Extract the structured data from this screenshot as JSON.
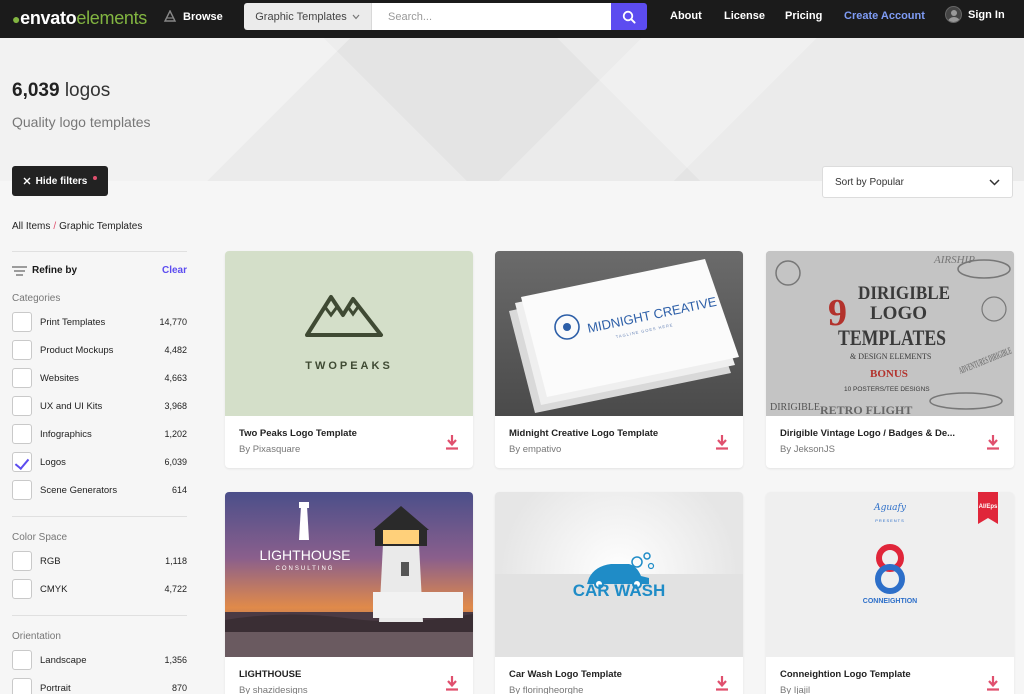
{
  "nav": {
    "logo_left": "envato",
    "logo_right": "elements",
    "browse": "Browse",
    "search_category": "Graphic Templates",
    "search_placeholder": "Search...",
    "links": {
      "about": "About",
      "license": "License",
      "pricing": "Pricing",
      "create": "Create Account",
      "signin": "Sign In"
    }
  },
  "hero": {
    "count": "6,039",
    "noun": "logos",
    "subtitle": "Quality logo templates"
  },
  "hide_filters": "Hide filters",
  "sort": "Sort by Popular",
  "breadcrumb": {
    "root": "All Items",
    "sep": "/",
    "current": "Graphic Templates"
  },
  "sidebar": {
    "refine": "Refine by",
    "clear": "Clear",
    "categories_title": "Categories",
    "categories": [
      {
        "label": "Print Templates",
        "count": "14,770",
        "checked": false
      },
      {
        "label": "Product Mockups",
        "count": "4,482",
        "checked": false
      },
      {
        "label": "Websites",
        "count": "4,663",
        "checked": false
      },
      {
        "label": "UX and UI Kits",
        "count": "3,968",
        "checked": false
      },
      {
        "label": "Infographics",
        "count": "1,202",
        "checked": false
      },
      {
        "label": "Logos",
        "count": "6,039",
        "checked": true
      },
      {
        "label": "Scene Generators",
        "count": "614",
        "checked": false
      }
    ],
    "color_title": "Color Space",
    "color": [
      {
        "label": "RGB",
        "count": "1,118"
      },
      {
        "label": "CMYK",
        "count": "4,722"
      }
    ],
    "orientation_title": "Orientation",
    "orientation": [
      {
        "label": "Landscape",
        "count": "1,356"
      },
      {
        "label": "Portrait",
        "count": "870"
      }
    ]
  },
  "cards": [
    {
      "title": "Two Peaks Logo Template",
      "author": "By Pixasquare",
      "thumb_text": "TWOPEAKS"
    },
    {
      "title": "Midnight Creative Logo Template",
      "author": "By empativo",
      "thumb_text": "MIDNIGHT CREATIVE",
      "thumb_sub": "TAGLINE GOES HERE"
    },
    {
      "title": "Dirigible Vintage Logo / Badges & De...",
      "author": "By JeksonJS",
      "thumb_text": "DIRIGIBLE LOGO TEMPLATES",
      "thumb_num": "9",
      "thumb_sub": "& DESIGN ELEMENTS",
      "thumb_bonus": "BONUS",
      "thumb_posters": "10 POSTERS/TEE DESIGNS",
      "thumb_footer_left": "DIRIGIBLE",
      "thumb_footer": "RETRO FLIGHT",
      "thumb_side": "ADVENTURES DIRIGIBLE",
      "thumb_top": "AIRSHIP"
    },
    {
      "title": "LIGHTHOUSE",
      "author": "By shazidesigns",
      "thumb_text": "LIGHTHOUSE",
      "thumb_sub": "CONSULTING"
    },
    {
      "title": "Car Wash Logo Template",
      "author": "By floringheorghe",
      "thumb_text": "CAR WASH"
    },
    {
      "title": "Conneightion Logo Template",
      "author": "By Ijajil",
      "thumb_text": "CONNEIGHTION",
      "thumb_badge": "AI/Eps",
      "thumb_script": "Aguafy",
      "thumb_presents": "PRESENTS"
    }
  ],
  "colors": {
    "accent": "#5c4cf0",
    "brand_green": "#82b541",
    "download_red": "#e0506e",
    "nav_bg": "#1b1b1b"
  }
}
